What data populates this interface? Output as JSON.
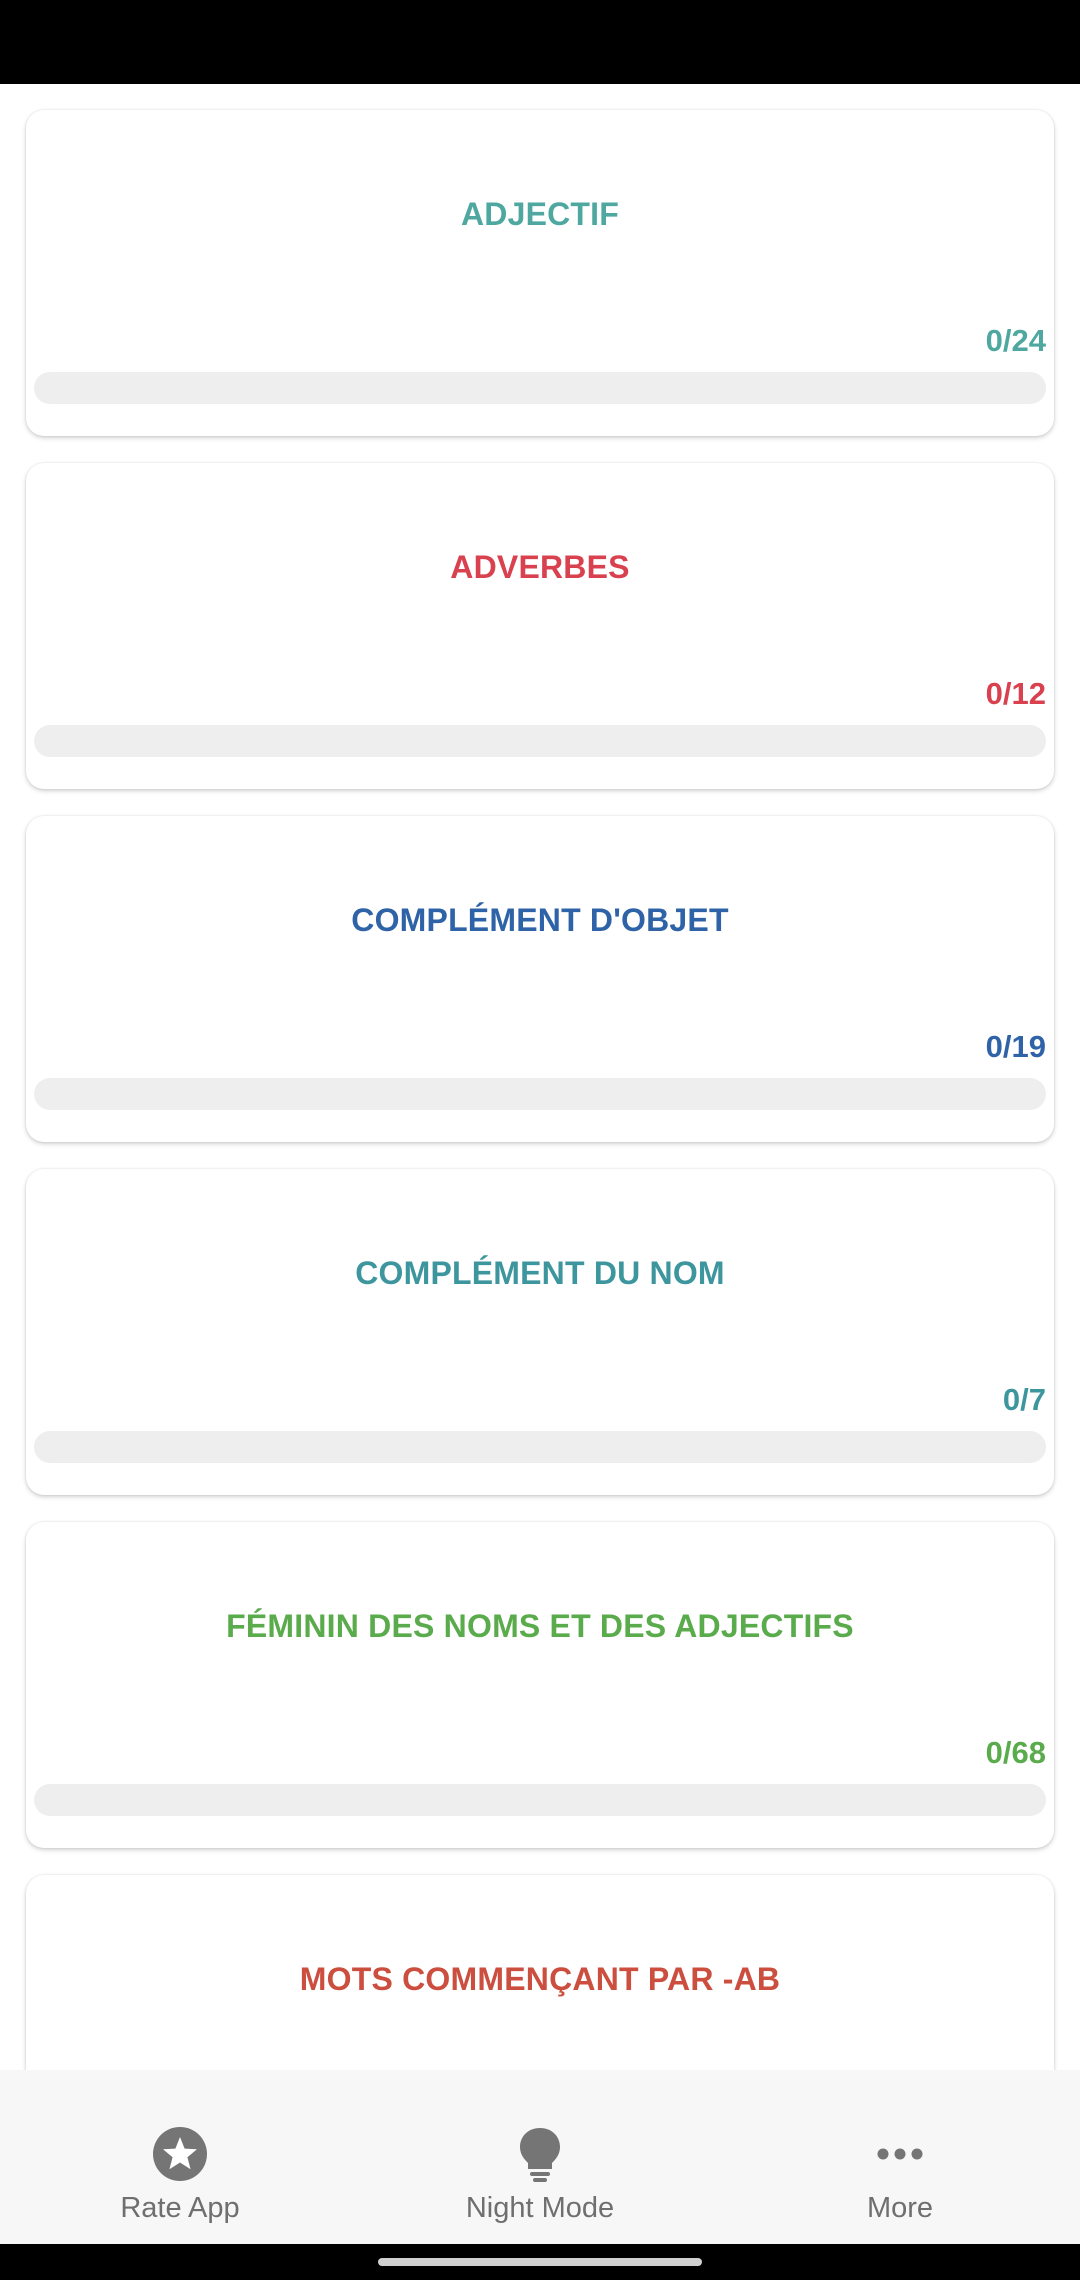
{
  "categories": [
    {
      "title": "ADJECTIF",
      "count": "0/24",
      "progress": 0,
      "color": "#4fa8a0"
    },
    {
      "title": "ADVERBES",
      "count": "0/12",
      "progress": 0,
      "color": "#d9414f"
    },
    {
      "title": "COMPLÉMENT D'OBJET",
      "count": "0/19",
      "progress": 0,
      "color": "#2f63a8"
    },
    {
      "title": "COMPLÉMENT DU NOM",
      "count": "0/7",
      "progress": 0,
      "color": "#3d969e"
    },
    {
      "title": "FÉMININ DES NOMS ET DES ADJECTIFS",
      "count": "0/68",
      "progress": 0,
      "color": "#5aab4c"
    },
    {
      "title": "MOTS COMMENÇANT PAR -AB",
      "count": "",
      "progress": 0,
      "color": "#cc4e3e"
    }
  ],
  "nav": {
    "rate": {
      "label": "Rate App",
      "icon": "star-icon"
    },
    "night": {
      "label": "Night Mode",
      "icon": "lightbulb-icon"
    },
    "more": {
      "label": "More",
      "icon": "more-dots-icon"
    }
  },
  "colors": {
    "nav_icon": "#757575",
    "nav_label": "#6f6f6f",
    "progress_track": "#eeeeee"
  }
}
